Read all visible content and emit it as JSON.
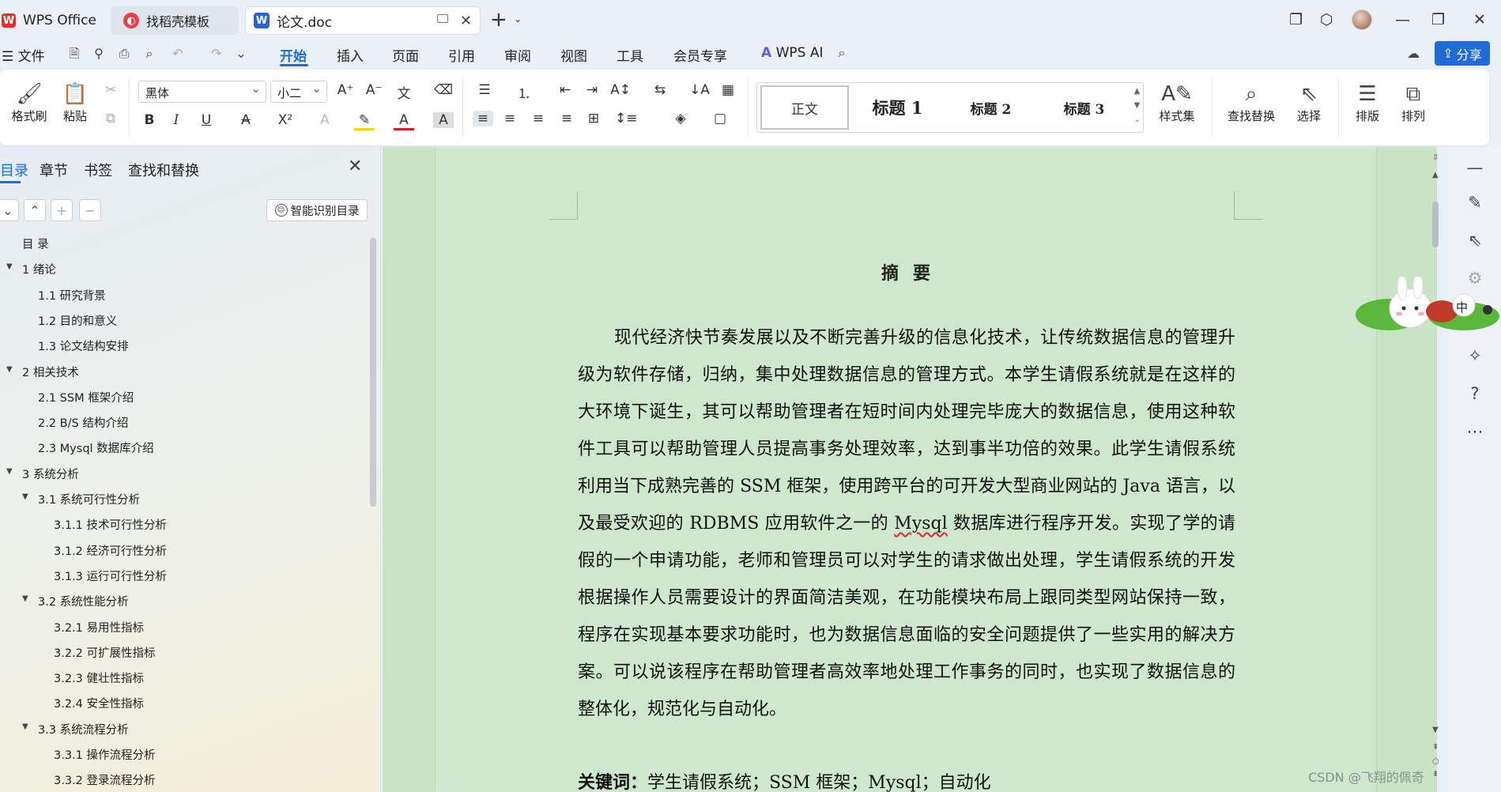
{
  "tabs": {
    "wps": "WPS Office",
    "template": "找稻壳模板",
    "doc": "论文.doc"
  },
  "menu": {
    "file": "文件",
    "items": [
      "开始",
      "插入",
      "页面",
      "引用",
      "审阅",
      "视图",
      "工具",
      "会员专享"
    ],
    "ai": "WPS AI",
    "share": "分享"
  },
  "ribbon": {
    "format_painter": "格式刷",
    "paste": "粘贴",
    "font": "黑体",
    "font_size": "小二",
    "styles": {
      "normal": "正文",
      "h1": "标题 1",
      "h2": "标题 2",
      "h3": "标题 3"
    },
    "style_set": "样式集",
    "find_replace": "查找替换",
    "select": "选择",
    "layout": "排版",
    "arrange": "排列"
  },
  "nav": {
    "tabs": [
      "目录",
      "章节",
      "书签",
      "查找和替换"
    ],
    "smart_toc": "智能识别目录",
    "toc": [
      {
        "text": "目 录",
        "level": 0
      },
      {
        "text": "1 绪论",
        "level": 0,
        "caret": true
      },
      {
        "text": "1.1 研究背景",
        "level": 1
      },
      {
        "text": "1.2 目的和意义",
        "level": 1
      },
      {
        "text": "1.3 论文结构安排",
        "level": 1
      },
      {
        "text": "2 相关技术",
        "level": 0,
        "caret": true
      },
      {
        "text": "2.1 SSM 框架介绍",
        "level": 1
      },
      {
        "text": "2.2 B/S 结构介绍",
        "level": 1
      },
      {
        "text": "2.3 Mysql 数据库介绍",
        "level": 1
      },
      {
        "text": "3 系统分析",
        "level": 0,
        "caret": true
      },
      {
        "text": "3.1 系统可行性分析",
        "level": 1,
        "caret": true
      },
      {
        "text": "3.1.1 技术可行性分析",
        "level": 2
      },
      {
        "text": "3.1.2 经济可行性分析",
        "level": 2
      },
      {
        "text": "3.1.3 运行可行性分析",
        "level": 2
      },
      {
        "text": "3.2 系统性能分析",
        "level": 1,
        "caret": true
      },
      {
        "text": "3.2.1 易用性指标",
        "level": 2
      },
      {
        "text": "3.2.2 可扩展性指标",
        "level": 2
      },
      {
        "text": "3.2.3 健壮性指标",
        "level": 2
      },
      {
        "text": "3.2.4 安全性指标",
        "level": 2
      },
      {
        "text": "3.3 系统流程分析",
        "level": 1,
        "caret": true
      },
      {
        "text": "3.3.1 操作流程分析",
        "level": 2
      },
      {
        "text": "3.3.2 登录流程分析",
        "level": 2
      }
    ]
  },
  "doc": {
    "title": "摘要",
    "abstract_pre": "现代经济快节奏发展以及不断完善升级的信息化技术，让传统数据信息的管理升级为软件存储，归纳，集中处理数据信息的管理方式。本学生请假系统就是在这样的大环境下诞生，其可以帮助管理者在短时间内处理完毕庞大的数据信息，使用这种软件工具可以帮助管理人员提高事务处理效率，达到事半功倍的效果。此学生请假系统利用当下成熟完善的 SSM 框架，使用跨平台的可开发大型商业网站的 Java 语言，以及最受欢迎的 RDBMS 应用软件之一的 ",
    "abstract_mysql": "Mysql",
    "abstract_post": " 数据库进行程序开发。实现了学的请假的一个申请功能，老师和管理员可以对学生的请求做出处理，学生请假系统的开发根据操作人员需要设计的界面简洁美观，在功能模块布局上跟同类型网站保持一致，程序在实现基本要求功能时，也为数据信息面临的安全问题提供了一些实用的解决方案。可以说该程序在帮助管理者高效率地处理工作事务的同时，也实现了数据信息的整体化，规范化与自动化。",
    "keywords_label": "关键词：",
    "keywords": "学生请假系统；SSM 框架；Mysql；自动化"
  },
  "watermark": "CSDN @飞翔的佩奇",
  "mascot_text": "中",
  "colors": {
    "accent": "#1f6cd6",
    "page_bg": "#cde8cc"
  }
}
